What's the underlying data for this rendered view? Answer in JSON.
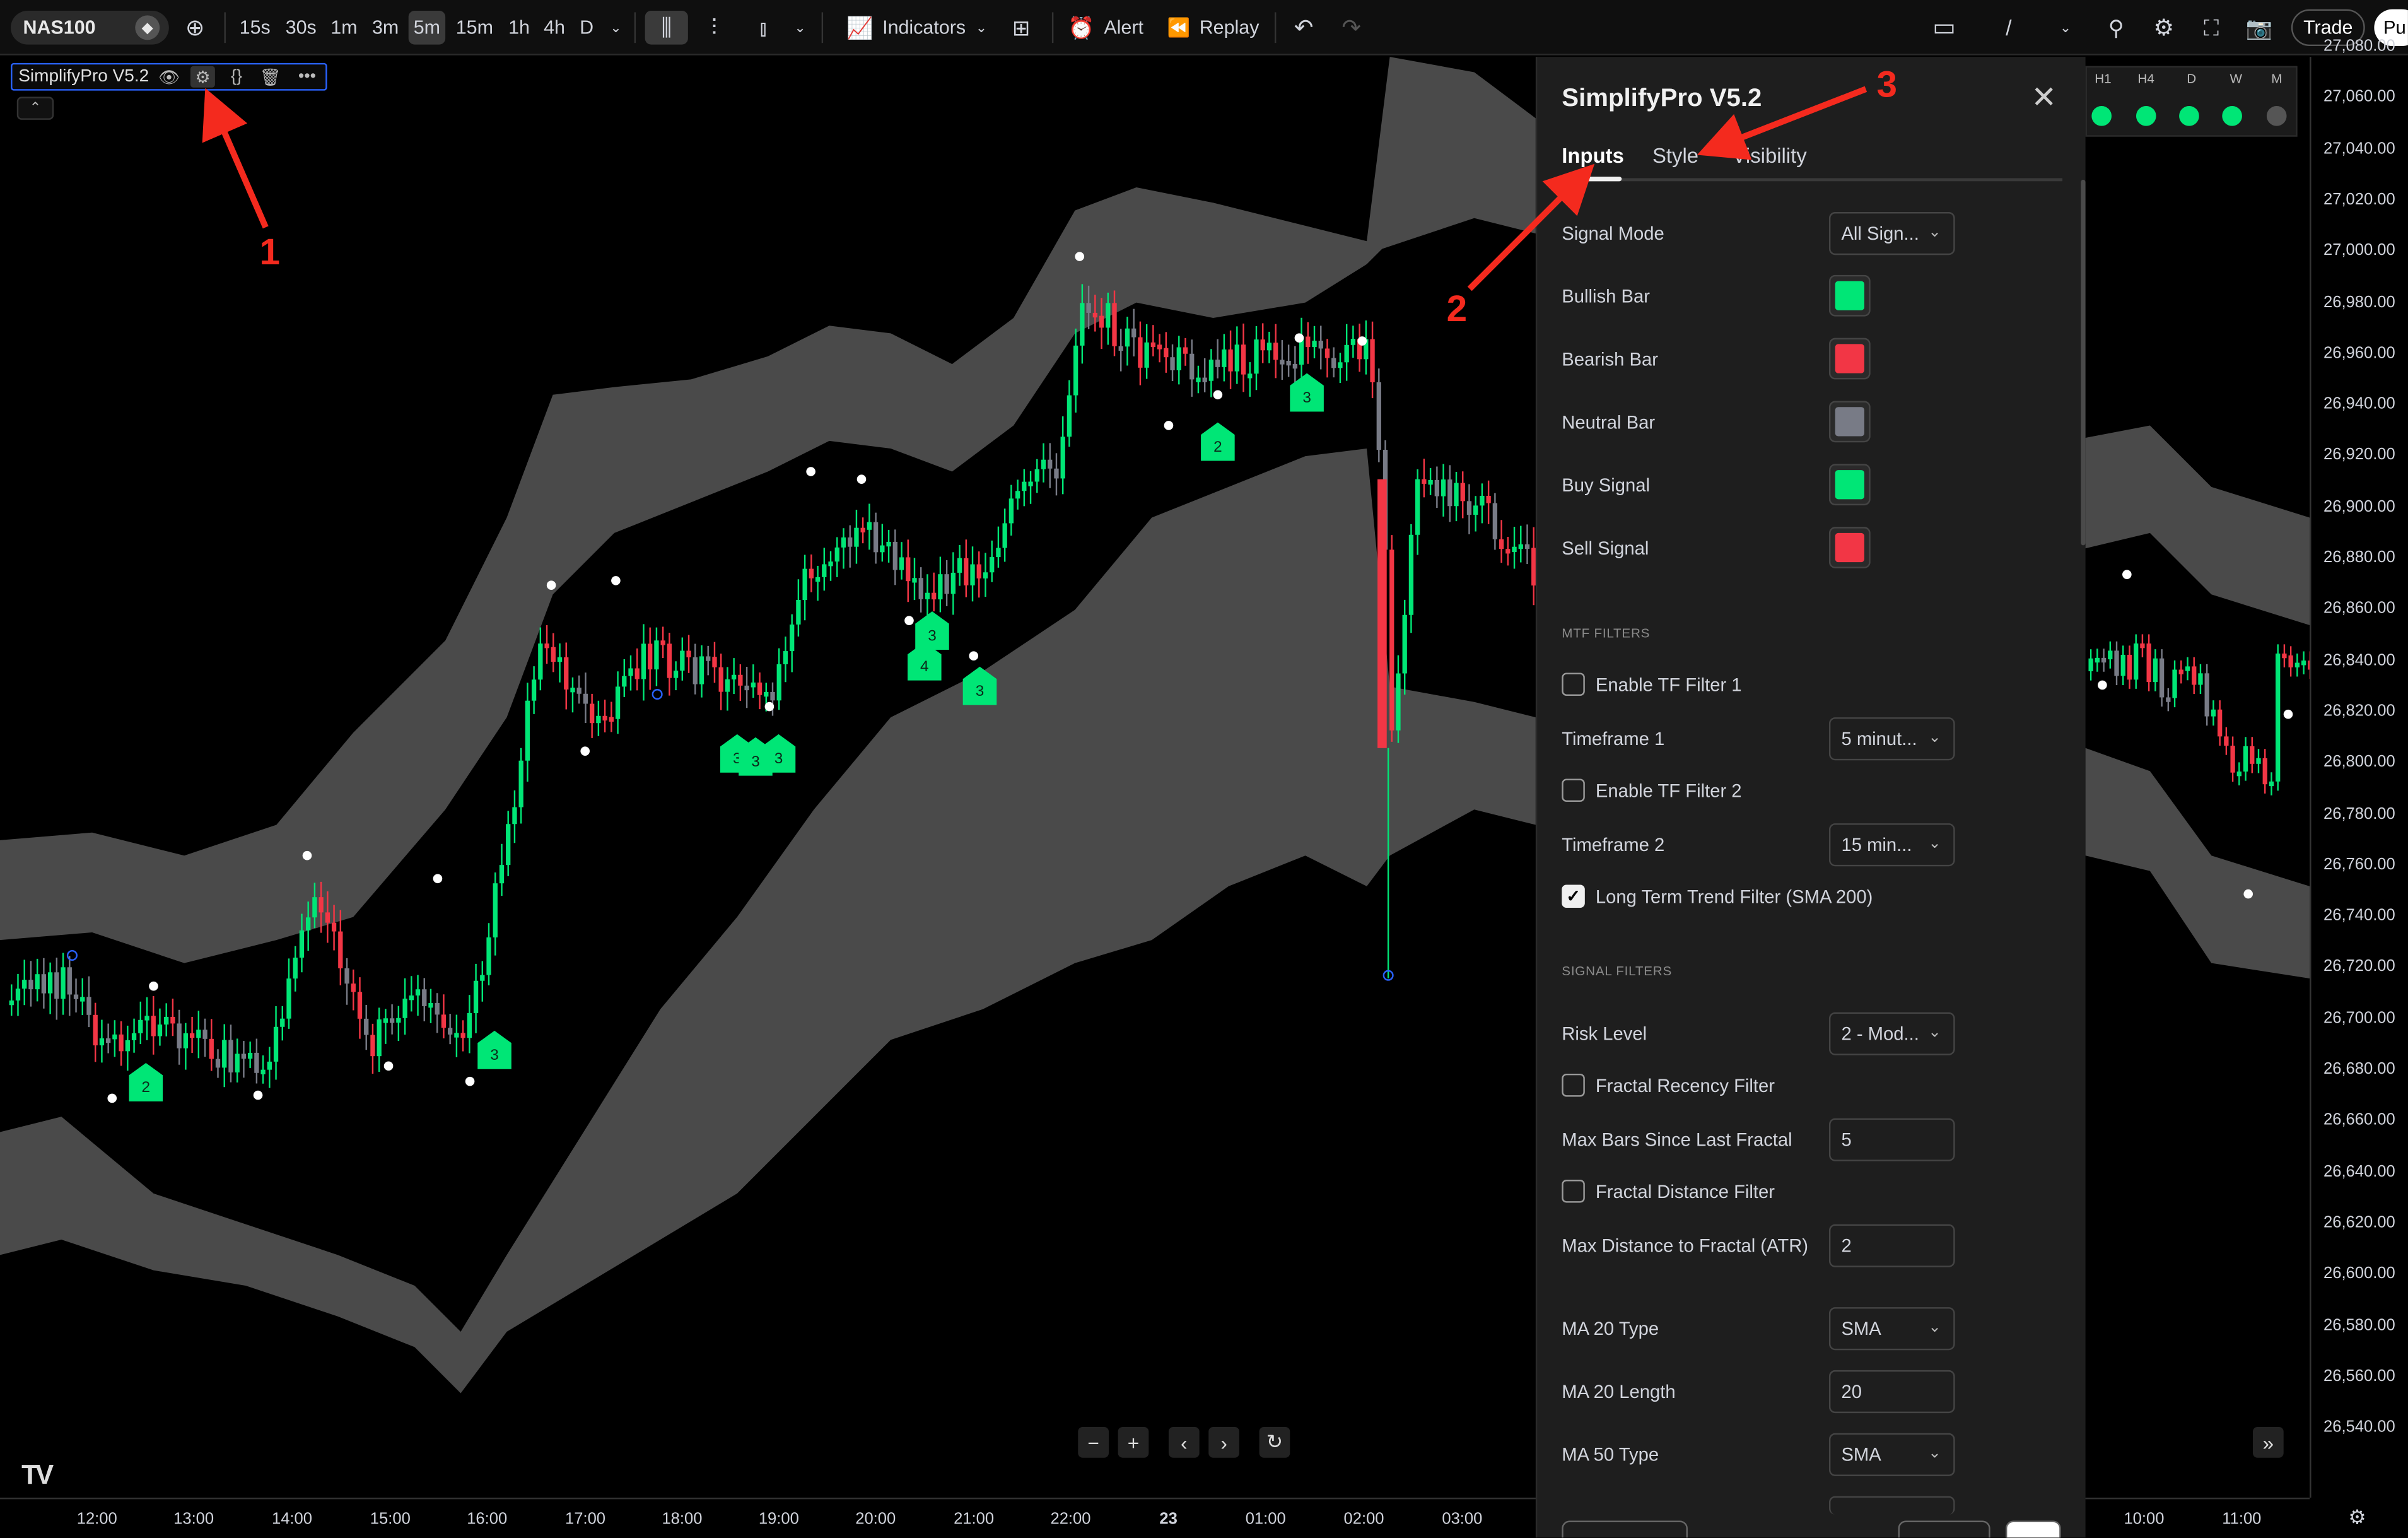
{
  "header": {
    "symbol": "NAS100",
    "timeframes": [
      "15s",
      "30s",
      "1m",
      "3m",
      "5m",
      "15m",
      "1h",
      "4h",
      "D"
    ],
    "active_timeframe": "5m",
    "indicators_label": "Indicators",
    "alert_label": "Alert",
    "replay_label": "Replay",
    "trade_label": "Trade",
    "publish_label": "Pu"
  },
  "indicator_legend": {
    "name": "SimplifyPro V5.2"
  },
  "price_axis": [
    "27,080.00",
    "27,060.00",
    "27,040.00",
    "27,020.00",
    "27,000.00",
    "26,980.00",
    "26,960.00",
    "26,940.00",
    "26,920.00",
    "26,900.00",
    "26,880.00",
    "26,860.00",
    "26,840.00",
    "26,820.00",
    "26,800.00",
    "26,780.00",
    "26,760.00",
    "26,740.00",
    "26,720.00",
    "26,700.00",
    "26,680.00",
    "26,660.00",
    "26,640.00",
    "26,620.00",
    "26,600.00",
    "26,580.00",
    "26,560.00",
    "26,540.00"
  ],
  "time_axis": [
    "12:00",
    "13:00",
    "14:00",
    "15:00",
    "16:00",
    "17:00",
    "18:00",
    "19:00",
    "20:00",
    "21:00",
    "22:00",
    "23",
    "01:00",
    "02:00",
    "03:00",
    "10:00",
    "11:00"
  ],
  "mtf_table": {
    "headers": [
      "H1",
      "H4",
      "D",
      "W",
      "M"
    ],
    "states": [
      "#00e676",
      "#00e676",
      "#00e676",
      "#00e676",
      "#555555"
    ]
  },
  "signal_markers": [
    "2",
    "3",
    "2",
    "3",
    "3",
    "4",
    "3",
    "3",
    "3",
    "3"
  ],
  "annotations": [
    "1",
    "2",
    "3"
  ],
  "settings": {
    "title": "SimplifyPro V5.2",
    "tabs": [
      "Inputs",
      "Style",
      "Visibility"
    ],
    "active_tab": "Inputs",
    "signal_mode_label": "Signal Mode",
    "signal_mode_value": "All Sign...",
    "colors": [
      {
        "label": "Bullish Bar",
        "color": "#00e676"
      },
      {
        "label": "Bearish Bar",
        "color": "#f23645"
      },
      {
        "label": "Neutral Bar",
        "color": "#787b86"
      },
      {
        "label": "Buy Signal",
        "color": "#00e676"
      },
      {
        "label": "Sell Signal",
        "color": "#f23645"
      }
    ],
    "mtf_section": "MTF FILTERS",
    "enable_tf1_label": "Enable TF Filter 1",
    "timeframe1_label": "Timeframe 1",
    "timeframe1_value": "5 minut...",
    "enable_tf2_label": "Enable TF Filter 2",
    "timeframe2_label": "Timeframe 2",
    "timeframe2_value": "15 min...",
    "long_term_label": "Long Term Trend Filter (SMA 200)",
    "signal_section": "SIGNAL FILTERS",
    "risk_label": "Risk Level",
    "risk_value": "2 - Mod...",
    "fractal_recency_label": "Fractal Recency Filter",
    "max_bars_label": "Max Bars Since Last Fractal",
    "max_bars_value": "5",
    "fractal_distance_label": "Fractal Distance Filter",
    "max_distance_label": "Max Distance to Fractal (ATR)",
    "max_distance_value": "2",
    "ma20_type_label": "MA 20 Type",
    "ma20_type_value": "SMA",
    "ma20_len_label": "MA 20 Length",
    "ma20_len_value": "20",
    "ma50_type_label": "MA 50 Type",
    "ma50_type_value": "SMA"
  }
}
